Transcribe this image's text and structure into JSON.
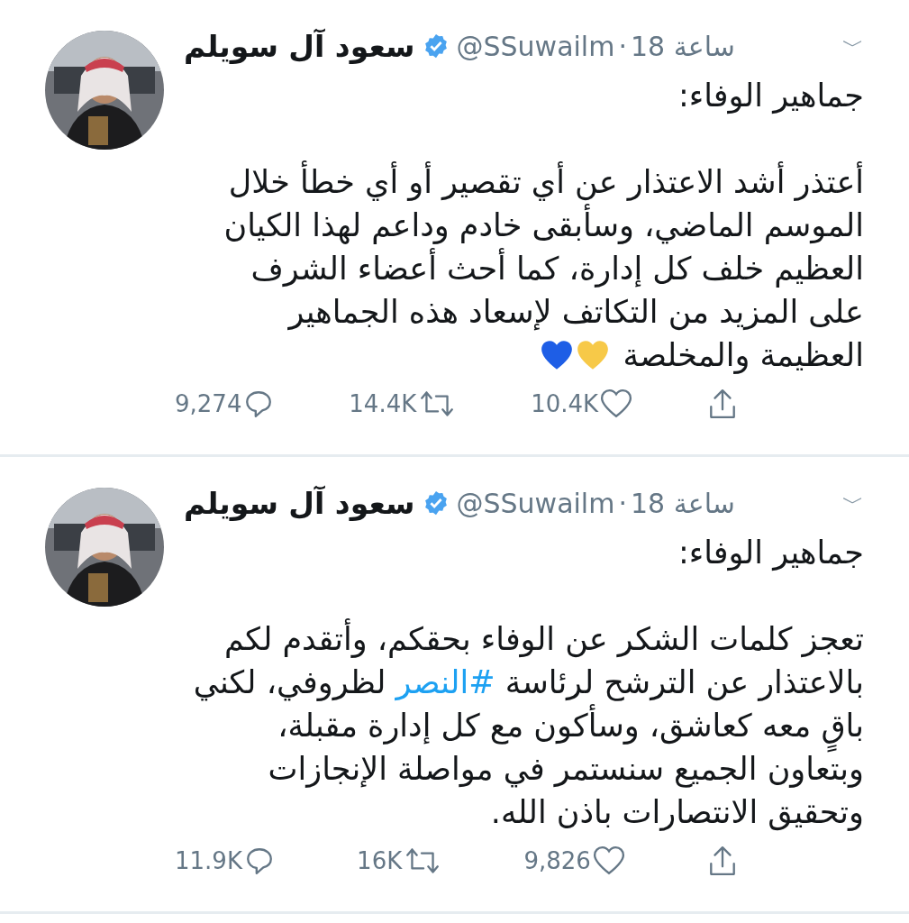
{
  "tweets": [
    {
      "name": "سعود آل سويلم",
      "verified": true,
      "handle": "@SSuwailm",
      "time": "18 ساعة",
      "separator": "·",
      "menu": "﹀",
      "greeting": "جماهير الوفاء:",
      "lines": [
        [
          {
            "kind": "text",
            "text": "أعتذر أشد الاعتذار عن أي تقصير أو أي خطأ خلال"
          }
        ],
        [
          {
            "kind": "text",
            "text": "الموسم الماضي، وسأبقى خادم وداعم لهذا الكيان"
          }
        ],
        [
          {
            "kind": "text",
            "text": "العظيم خلف كل إدارة، كما أحث أعضاء الشرف"
          }
        ],
        [
          {
            "kind": "text",
            "text": "على المزيد من التكاتف لإسعاد هذه الجماهير"
          }
        ],
        [
          {
            "kind": "text",
            "text": "العظيمة والمخلصة "
          },
          {
            "kind": "heart",
            "color": "#f7c948"
          },
          {
            "kind": "heart",
            "color": "#1e5ee6"
          }
        ]
      ],
      "replies": "9,274",
      "retweets": "14.4K",
      "likes": "10.4K"
    },
    {
      "name": "سعود آل سويلم",
      "verified": true,
      "handle": "@SSuwailm",
      "time": "18 ساعة",
      "separator": "·",
      "menu": "﹀",
      "greeting": "جماهير الوفاء:",
      "lines": [
        [
          {
            "kind": "text",
            "text": "تعجز كلمات الشكر عن الوفاء بحقكم، وأتقدم لكم"
          }
        ],
        [
          {
            "kind": "text",
            "text": "بالاعتذار عن الترشح لرئاسة "
          },
          {
            "kind": "hashtag",
            "text": "#النصر"
          },
          {
            "kind": "text",
            "text": " لظروفي، لكني"
          }
        ],
        [
          {
            "kind": "text",
            "text": "باقٍ معه كعاشق، وسأكون مع كل إدارة مقبلة،"
          }
        ],
        [
          {
            "kind": "text",
            "text": "وبتعاون الجميع سنستمر في مواصلة الإنجازات"
          }
        ],
        [
          {
            "kind": "text",
            "text": "وتحقيق الانتصارات باذن الله."
          }
        ]
      ],
      "replies": "11.9K",
      "retweets": "16K",
      "likes": "9,826"
    }
  ]
}
